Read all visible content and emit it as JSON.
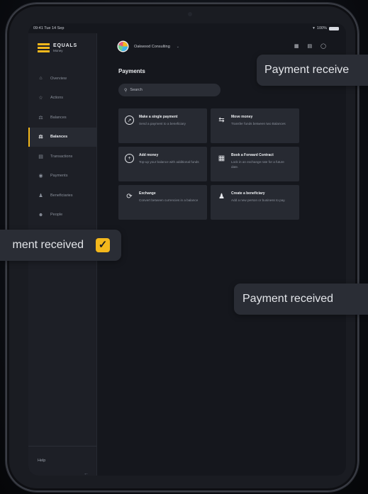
{
  "status_bar": {
    "time": "09:41  Tue 14 Sep",
    "wifi": "wifi-icon",
    "battery": "100%"
  },
  "brand": {
    "name": "EQUALS",
    "sub": "Money",
    "accent": "#f4b81c"
  },
  "sidebar": {
    "items": [
      {
        "label": "Overview",
        "icon": "home-icon"
      },
      {
        "label": "Actions",
        "icon": "star-icon"
      },
      {
        "label": "Balances",
        "icon": "bank-icon"
      },
      {
        "label": "Balances",
        "icon": "bank-icon",
        "active": true
      },
      {
        "label": "Transactions",
        "icon": "list-icon"
      },
      {
        "label": "Payments",
        "icon": "payments-icon"
      },
      {
        "label": "Beneficiaries",
        "icon": "beneficiaries-icon"
      },
      {
        "label": "People",
        "icon": "people-icon"
      }
    ],
    "help": "Help"
  },
  "header": {
    "org_name": "Oakwood Consulting"
  },
  "page": {
    "title": "Payments",
    "search_placeholder": "Search"
  },
  "cards": [
    {
      "title": "Make a single payment",
      "desc": "Send a payment to a beneficiary",
      "icon": "send-arrow-icon"
    },
    {
      "title": "Move money",
      "desc": "Transfer funds between two Balances",
      "icon": "swap-arrows-icon"
    },
    {
      "title": "Add money",
      "desc": "Top-up your balance with additional funds",
      "icon": "plus-circle-icon"
    },
    {
      "title": "Book a Forward Contract",
      "desc": "Lock in an exchange rate for a future date.",
      "icon": "calendar-icon"
    },
    {
      "title": "Exchange",
      "desc": "Convert between currencies in a balance",
      "icon": "exchange-icon"
    },
    {
      "title": "Create a beneficiary",
      "desc": "Add a new person or business to pay.",
      "icon": "add-beneficiary-icon"
    }
  ],
  "toasts": {
    "top": "Payment receive",
    "left": "ment received",
    "right": "Payment received"
  }
}
